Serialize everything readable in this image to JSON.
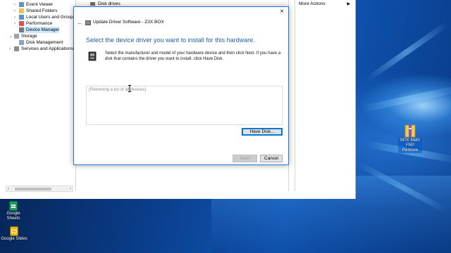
{
  "mgmt_window": {
    "tree_items": [
      {
        "label": "Event Viewer",
        "expanded": false
      },
      {
        "label": "Shared Folders",
        "expanded": false
      },
      {
        "label": "Local Users and Groups",
        "expanded": false
      },
      {
        "label": "Performance",
        "expanded": false
      },
      {
        "label": "Device Manager",
        "expanded": false,
        "selected": true
      },
      {
        "label": "Storage",
        "expanded": true
      },
      {
        "label": "Disk Management",
        "expanded": false
      },
      {
        "label": "Services and Applications",
        "expanded": false
      }
    ],
    "middle_item": "Disk drives",
    "actions_label": "More Actions"
  },
  "dialog": {
    "window_title": "Update Driver Software - Z3X BOX",
    "heading": "Select the device driver you want to install for this hardware.",
    "instruction": "Select the manufacturer and model of your hardware device and then click Next. If you have a disk that contains the driver you want to install, click Have Disk.",
    "list_placeholder": "(Retrieving a list of all devices)",
    "have_disk_label": "Have Disk...",
    "next_label": "Next",
    "cancel_label": "Cancel",
    "close_glyph": "×",
    "back_glyph": "←"
  },
  "desktop": {
    "icons": [
      {
        "label": "Google Sheets",
        "icon": "google-sheets-icon",
        "color": "#1e9d57"
      },
      {
        "label": "Google Slides",
        "icon": "google-slides-icon",
        "color": "#f4b400"
      },
      {
        "label": "MTK 6580 FRP Remove",
        "icon": "archive-icon",
        "color": "#f2c94c"
      }
    ],
    "edge_labels": [
      "Re",
      "Go",
      "Go"
    ]
  },
  "colors": {
    "accent": "#0078d7",
    "heading_blue": "#1c5fa8"
  }
}
